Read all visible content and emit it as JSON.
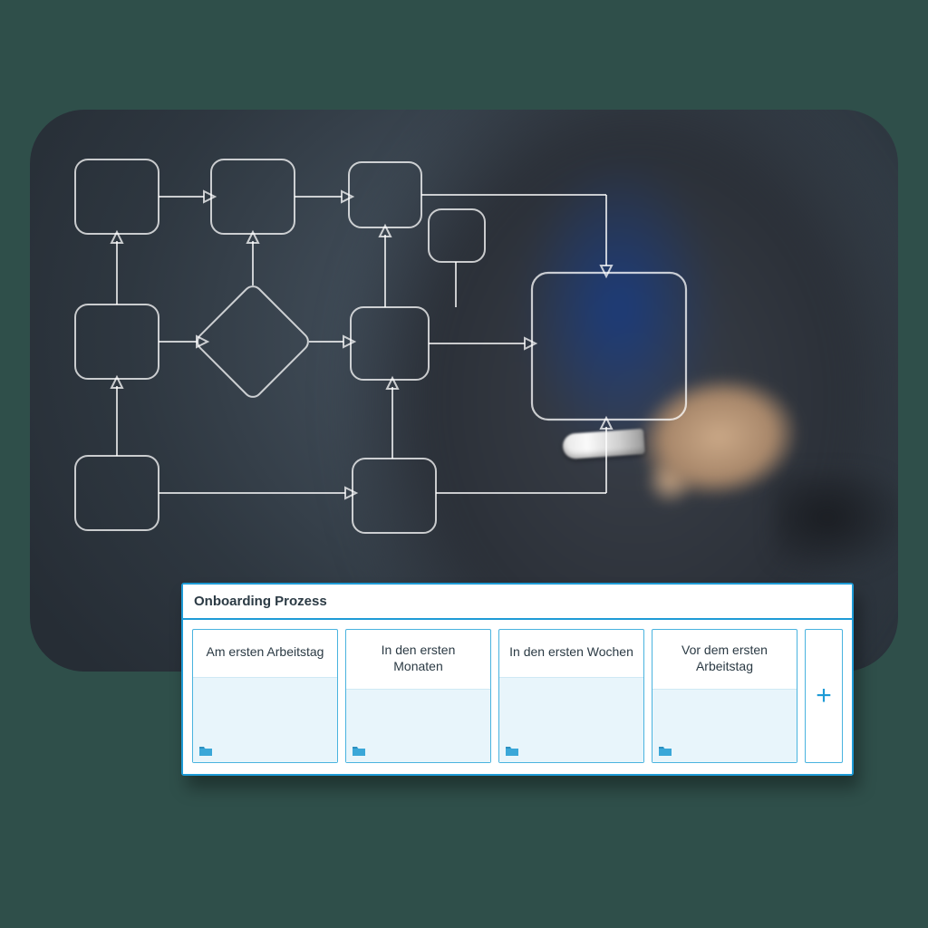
{
  "panel": {
    "title": "Onboarding Prozess",
    "add_label": "+",
    "cards": [
      {
        "title": "Am ersten Arbeitstag"
      },
      {
        "title": "In den ersten Monaten"
      },
      {
        "title": "In den ersten Wochen"
      },
      {
        "title": "Vor dem ersten Arbeitstag"
      }
    ]
  },
  "colors": {
    "accent": "#1e9bd6",
    "card_body": "#e8f5fb",
    "page_bg": "#2f4f4a"
  }
}
